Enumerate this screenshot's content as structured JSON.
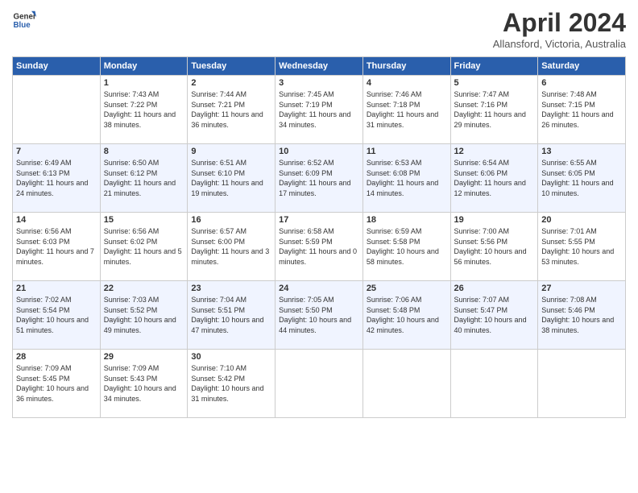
{
  "header": {
    "logo_line1": "General",
    "logo_line2": "Blue",
    "title": "April 2024",
    "location": "Allansford, Victoria, Australia"
  },
  "columns": [
    "Sunday",
    "Monday",
    "Tuesday",
    "Wednesday",
    "Thursday",
    "Friday",
    "Saturday"
  ],
  "weeks": [
    [
      {
        "day": "",
        "sunrise": "",
        "sunset": "",
        "daylight": ""
      },
      {
        "day": "1",
        "sunrise": "Sunrise: 7:43 AM",
        "sunset": "Sunset: 7:22 PM",
        "daylight": "Daylight: 11 hours and 38 minutes."
      },
      {
        "day": "2",
        "sunrise": "Sunrise: 7:44 AM",
        "sunset": "Sunset: 7:21 PM",
        "daylight": "Daylight: 11 hours and 36 minutes."
      },
      {
        "day": "3",
        "sunrise": "Sunrise: 7:45 AM",
        "sunset": "Sunset: 7:19 PM",
        "daylight": "Daylight: 11 hours and 34 minutes."
      },
      {
        "day": "4",
        "sunrise": "Sunrise: 7:46 AM",
        "sunset": "Sunset: 7:18 PM",
        "daylight": "Daylight: 11 hours and 31 minutes."
      },
      {
        "day": "5",
        "sunrise": "Sunrise: 7:47 AM",
        "sunset": "Sunset: 7:16 PM",
        "daylight": "Daylight: 11 hours and 29 minutes."
      },
      {
        "day": "6",
        "sunrise": "Sunrise: 7:48 AM",
        "sunset": "Sunset: 7:15 PM",
        "daylight": "Daylight: 11 hours and 26 minutes."
      }
    ],
    [
      {
        "day": "7",
        "sunrise": "Sunrise: 6:49 AM",
        "sunset": "Sunset: 6:13 PM",
        "daylight": "Daylight: 11 hours and 24 minutes."
      },
      {
        "day": "8",
        "sunrise": "Sunrise: 6:50 AM",
        "sunset": "Sunset: 6:12 PM",
        "daylight": "Daylight: 11 hours and 21 minutes."
      },
      {
        "day": "9",
        "sunrise": "Sunrise: 6:51 AM",
        "sunset": "Sunset: 6:10 PM",
        "daylight": "Daylight: 11 hours and 19 minutes."
      },
      {
        "day": "10",
        "sunrise": "Sunrise: 6:52 AM",
        "sunset": "Sunset: 6:09 PM",
        "daylight": "Daylight: 11 hours and 17 minutes."
      },
      {
        "day": "11",
        "sunrise": "Sunrise: 6:53 AM",
        "sunset": "Sunset: 6:08 PM",
        "daylight": "Daylight: 11 hours and 14 minutes."
      },
      {
        "day": "12",
        "sunrise": "Sunrise: 6:54 AM",
        "sunset": "Sunset: 6:06 PM",
        "daylight": "Daylight: 11 hours and 12 minutes."
      },
      {
        "day": "13",
        "sunrise": "Sunrise: 6:55 AM",
        "sunset": "Sunset: 6:05 PM",
        "daylight": "Daylight: 11 hours and 10 minutes."
      }
    ],
    [
      {
        "day": "14",
        "sunrise": "Sunrise: 6:56 AM",
        "sunset": "Sunset: 6:03 PM",
        "daylight": "Daylight: 11 hours and 7 minutes."
      },
      {
        "day": "15",
        "sunrise": "Sunrise: 6:56 AM",
        "sunset": "Sunset: 6:02 PM",
        "daylight": "Daylight: 11 hours and 5 minutes."
      },
      {
        "day": "16",
        "sunrise": "Sunrise: 6:57 AM",
        "sunset": "Sunset: 6:00 PM",
        "daylight": "Daylight: 11 hours and 3 minutes."
      },
      {
        "day": "17",
        "sunrise": "Sunrise: 6:58 AM",
        "sunset": "Sunset: 5:59 PM",
        "daylight": "Daylight: 11 hours and 0 minutes."
      },
      {
        "day": "18",
        "sunrise": "Sunrise: 6:59 AM",
        "sunset": "Sunset: 5:58 PM",
        "daylight": "Daylight: 10 hours and 58 minutes."
      },
      {
        "day": "19",
        "sunrise": "Sunrise: 7:00 AM",
        "sunset": "Sunset: 5:56 PM",
        "daylight": "Daylight: 10 hours and 56 minutes."
      },
      {
        "day": "20",
        "sunrise": "Sunrise: 7:01 AM",
        "sunset": "Sunset: 5:55 PM",
        "daylight": "Daylight: 10 hours and 53 minutes."
      }
    ],
    [
      {
        "day": "21",
        "sunrise": "Sunrise: 7:02 AM",
        "sunset": "Sunset: 5:54 PM",
        "daylight": "Daylight: 10 hours and 51 minutes."
      },
      {
        "day": "22",
        "sunrise": "Sunrise: 7:03 AM",
        "sunset": "Sunset: 5:52 PM",
        "daylight": "Daylight: 10 hours and 49 minutes."
      },
      {
        "day": "23",
        "sunrise": "Sunrise: 7:04 AM",
        "sunset": "Sunset: 5:51 PM",
        "daylight": "Daylight: 10 hours and 47 minutes."
      },
      {
        "day": "24",
        "sunrise": "Sunrise: 7:05 AM",
        "sunset": "Sunset: 5:50 PM",
        "daylight": "Daylight: 10 hours and 44 minutes."
      },
      {
        "day": "25",
        "sunrise": "Sunrise: 7:06 AM",
        "sunset": "Sunset: 5:48 PM",
        "daylight": "Daylight: 10 hours and 42 minutes."
      },
      {
        "day": "26",
        "sunrise": "Sunrise: 7:07 AM",
        "sunset": "Sunset: 5:47 PM",
        "daylight": "Daylight: 10 hours and 40 minutes."
      },
      {
        "day": "27",
        "sunrise": "Sunrise: 7:08 AM",
        "sunset": "Sunset: 5:46 PM",
        "daylight": "Daylight: 10 hours and 38 minutes."
      }
    ],
    [
      {
        "day": "28",
        "sunrise": "Sunrise: 7:09 AM",
        "sunset": "Sunset: 5:45 PM",
        "daylight": "Daylight: 10 hours and 36 minutes."
      },
      {
        "day": "29",
        "sunrise": "Sunrise: 7:09 AM",
        "sunset": "Sunset: 5:43 PM",
        "daylight": "Daylight: 10 hours and 34 minutes."
      },
      {
        "day": "30",
        "sunrise": "Sunrise: 7:10 AM",
        "sunset": "Sunset: 5:42 PM",
        "daylight": "Daylight: 10 hours and 31 minutes."
      },
      {
        "day": "",
        "sunrise": "",
        "sunset": "",
        "daylight": ""
      },
      {
        "day": "",
        "sunrise": "",
        "sunset": "",
        "daylight": ""
      },
      {
        "day": "",
        "sunrise": "",
        "sunset": "",
        "daylight": ""
      },
      {
        "day": "",
        "sunrise": "",
        "sunset": "",
        "daylight": ""
      }
    ]
  ]
}
